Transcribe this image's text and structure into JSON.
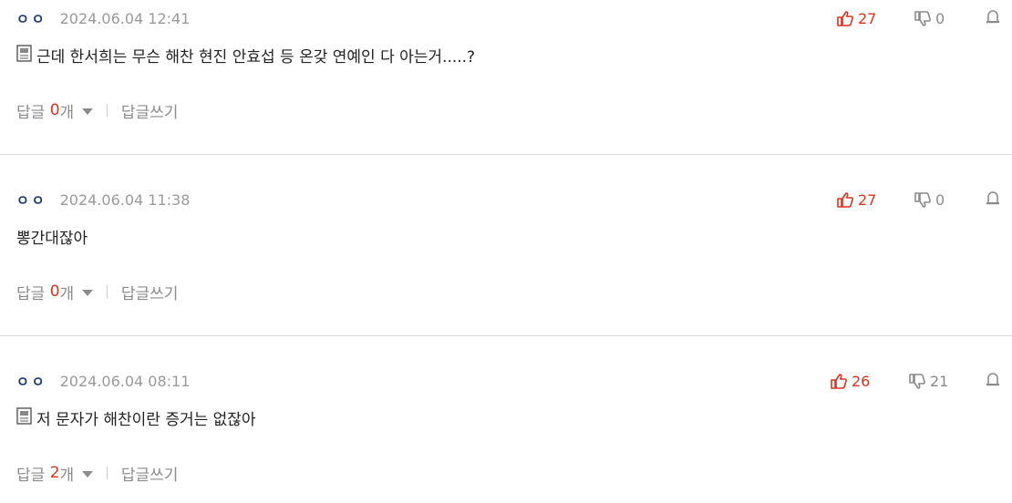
{
  "comments": [
    {
      "author": "ㅇㅇ",
      "date": "2024.06.04 12:41",
      "likes": "27",
      "dislikes": "0",
      "text": "근데 한서희는 무슨 해찬 현진 안효섭 등 온갖 연예인 다 아는거.....?",
      "has_doc_icon": true,
      "reply_label": "답글",
      "reply_count": "0",
      "reply_unit": "개",
      "write_label": "답글쓰기"
    },
    {
      "author": "ㅇㅇ",
      "date": "2024.06.04 11:38",
      "likes": "27",
      "dislikes": "0",
      "text": "뽕간대잖아",
      "has_doc_icon": false,
      "reply_label": "답글",
      "reply_count": "0",
      "reply_unit": "개",
      "write_label": "답글쓰기"
    },
    {
      "author": "ㅇㅇ",
      "date": "2024.06.04 08:11",
      "likes": "26",
      "dislikes": "21",
      "text": "저 문자가 해찬이란 증거는 없잖아",
      "has_doc_icon": true,
      "reply_label": "답글",
      "reply_count": "2",
      "reply_unit": "개",
      "write_label": "답글쓰기"
    }
  ],
  "colors": {
    "accent_red": "#d9321f",
    "muted": "#9a9a9a",
    "author": "#1f3a6e",
    "divider": "#d9d9d9"
  },
  "icons": {
    "like": "thumbs-up-icon",
    "dislike": "thumbs-down-icon",
    "report": "siren-icon",
    "doc": "document-icon"
  }
}
